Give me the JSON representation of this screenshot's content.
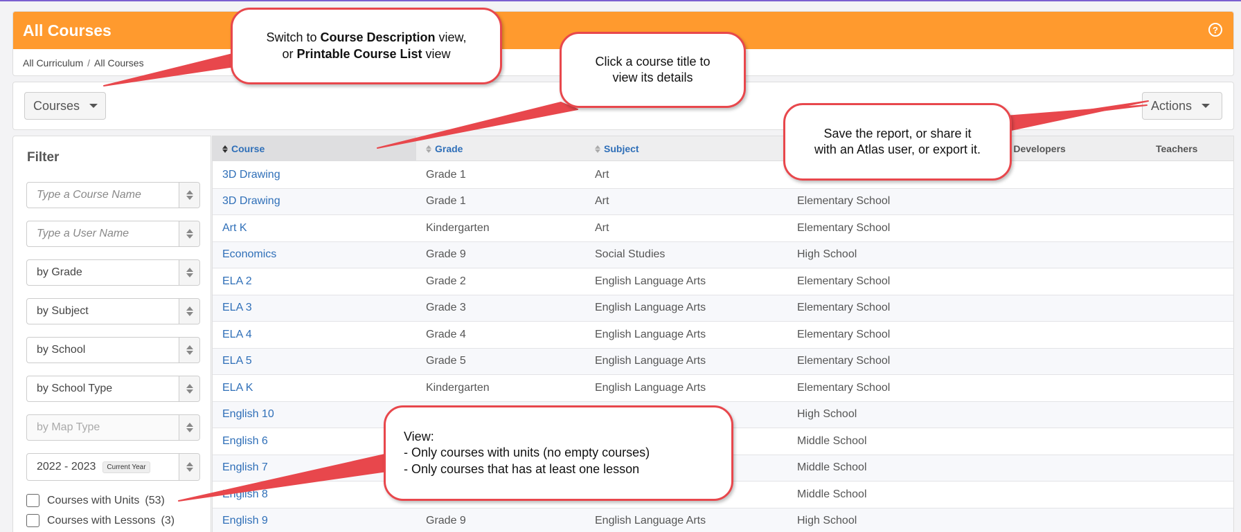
{
  "header": {
    "title": "All Courses",
    "breadcrumb": [
      "All Curriculum",
      "All Courses"
    ],
    "help_icon": "question-circle-icon"
  },
  "toolbar": {
    "view_dropdown_label": "Courses",
    "actions_label": "Actions"
  },
  "filter": {
    "title": "Filter",
    "course_name_placeholder": "Type a Course Name",
    "user_name_placeholder": "Type a User Name",
    "grade": "by Grade",
    "subject": "by Subject",
    "school": "by School",
    "school_type": "by School Type",
    "map_type": "by Map Type",
    "year": "2022 - 2023",
    "year_badge": "Current Year",
    "checkboxes": [
      {
        "label": "Courses with Units",
        "count": "(53)"
      },
      {
        "label": "Courses with Lessons",
        "count": "(3)"
      }
    ]
  },
  "table": {
    "columns": [
      "Course",
      "Grade",
      "Subject",
      "m Developers",
      "Teachers"
    ],
    "rows": [
      {
        "course": "3D Drawing",
        "grade": "Grade 1",
        "subject": "Art",
        "school_type": ""
      },
      {
        "course": "3D Drawing",
        "grade": "Grade 1",
        "subject": "Art",
        "school_type": "Elementary School"
      },
      {
        "course": "Art K",
        "grade": "Kindergarten",
        "subject": "Art",
        "school_type": "Elementary School"
      },
      {
        "course": "Economics",
        "grade": "Grade 9",
        "subject": "Social Studies",
        "school_type": "High School"
      },
      {
        "course": "ELA 2",
        "grade": "Grade 2",
        "subject": "English Language Arts",
        "school_type": "Elementary School"
      },
      {
        "course": "ELA 3",
        "grade": "Grade 3",
        "subject": "English Language Arts",
        "school_type": "Elementary School"
      },
      {
        "course": "ELA 4",
        "grade": "Grade 4",
        "subject": "English Language Arts",
        "school_type": "Elementary School"
      },
      {
        "course": "ELA 5",
        "grade": "Grade 5",
        "subject": "English Language Arts",
        "school_type": "Elementary School"
      },
      {
        "course": "ELA K",
        "grade": "Kindergarten",
        "subject": "English Language Arts",
        "school_type": "Elementary School"
      },
      {
        "course": "English 10",
        "grade": "",
        "subject": "",
        "school_type": "High School"
      },
      {
        "course": "English 6",
        "grade": "",
        "subject": "",
        "school_type": "Middle School"
      },
      {
        "course": "English 7",
        "grade": "",
        "subject": "",
        "school_type": "Middle School"
      },
      {
        "course": "English 8",
        "grade": "",
        "subject": "",
        "school_type": "Middle School"
      },
      {
        "course": "English 9",
        "grade": "Grade 9",
        "subject": "English Language Arts",
        "school_type": "High School"
      }
    ]
  },
  "callouts": {
    "view_switch": {
      "prefix": "Switch to ",
      "bold1": "Course Description",
      "middle": " view,",
      "line2_prefix": "or ",
      "bold2": "Printable Course List",
      "suffix": " view"
    },
    "course_title": {
      "line1": "Click a course title to",
      "line2": "view its details"
    },
    "actions": {
      "line1": "Save the report, or share it",
      "line2": "with an Atlas user, or export it."
    },
    "filters": {
      "line1": "View:",
      "line2": "- Only courses with units (no empty courses)",
      "line3": "- Only courses that has at least one lesson"
    }
  },
  "colors": {
    "header_orange": "#ff9a2e",
    "link_blue": "#2f6fb8",
    "callout_red": "#e8474c"
  }
}
